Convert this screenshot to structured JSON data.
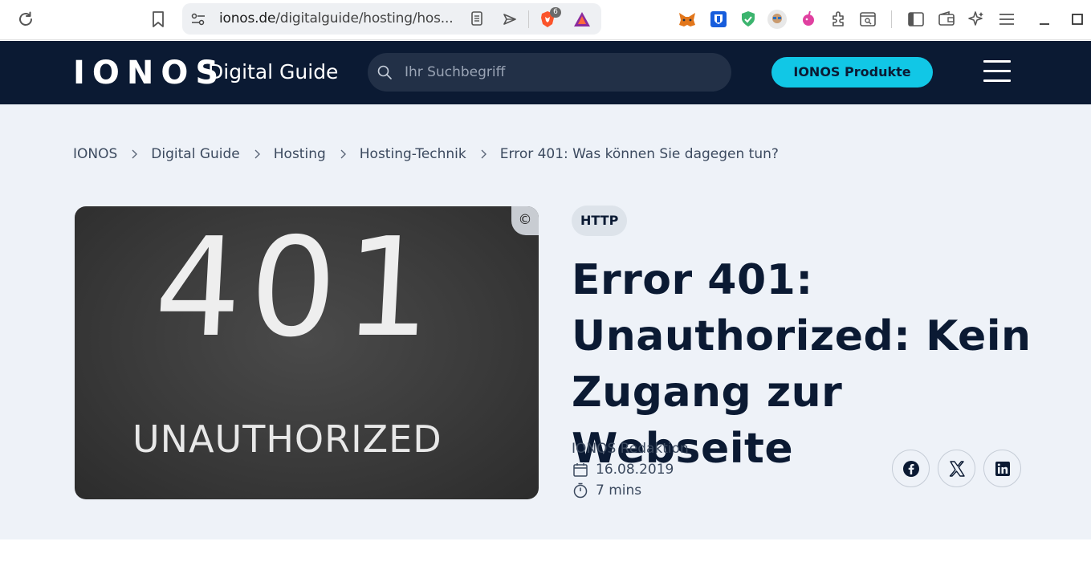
{
  "browser": {
    "url_host": "ionos.de",
    "url_path": "/digitalguide/hosting/hos...",
    "shields_count": "6"
  },
  "header": {
    "logo": "IONOS",
    "guide_title": "Digital Guide",
    "search_placeholder": "Ihr Suchbegriff",
    "products_button": "IONOS Produkte"
  },
  "breadcrumb": [
    "IONOS",
    "Digital Guide",
    "Hosting",
    "Hosting-Technik",
    "Error 401: Was können Sie dagegen tun?"
  ],
  "hero": {
    "image_big_text": "401",
    "image_small_text": "UNAUTHORIZED",
    "copyright": "©"
  },
  "article": {
    "tag": "HTTP",
    "title_lines": [
      "Error 401:",
      "Unauthorized: Kein",
      "Zugang zur Webseite"
    ],
    "author": "IONOS Redaktion",
    "date": "16.08.2019",
    "read_time": "7 mins"
  },
  "share": {
    "icons": [
      "facebook-icon",
      "x-icon",
      "linkedin-icon"
    ]
  },
  "colors": {
    "header_bg": "#0b1a33",
    "accent": "#11c7e6",
    "page_bg": "#eef2f8"
  }
}
